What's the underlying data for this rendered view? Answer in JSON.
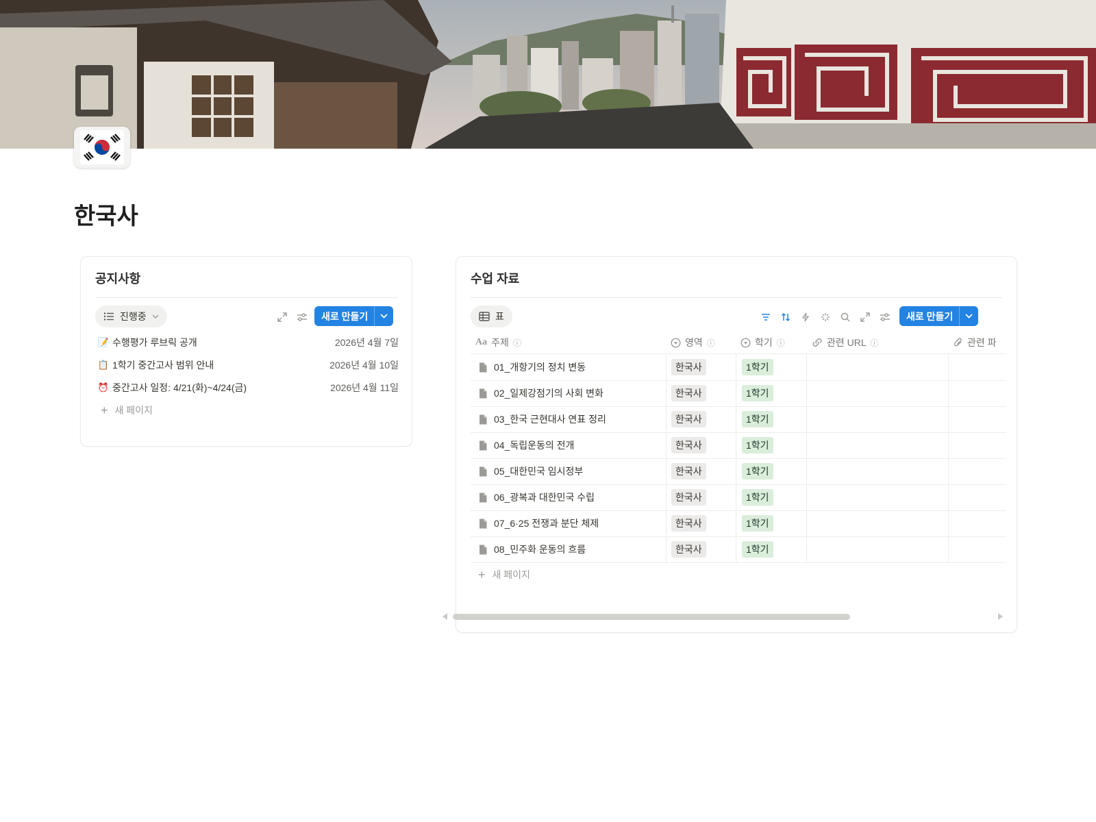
{
  "page": {
    "title": "한국사",
    "cover_alt": "hanok-village-cover"
  },
  "notices": {
    "title": "공지사항",
    "view_label": "진행중",
    "new_button": "새로 만들기",
    "items": [
      {
        "emoji": "📝",
        "title": "수행평가 루브릭 공개",
        "date": "2026년 4월 7일"
      },
      {
        "emoji": "📋",
        "title": "1학기 중간고사 범위 안내",
        "date": "2026년 4월 10일"
      },
      {
        "emoji": "⏰",
        "title": "중간고사 일정: 4/21(화)~4/24(금)",
        "date": "2026년 4월 11일"
      }
    ],
    "new_page": "새 페이지"
  },
  "materials": {
    "title": "수업 자료",
    "view_label": "표",
    "new_button": "새로 만들기",
    "columns": {
      "title": "주제",
      "area": "영역",
      "semester": "학기",
      "url": "관련 URL",
      "file": "관련 파"
    },
    "rows": [
      {
        "title": "01_개항기의 정치 변동",
        "area": "한국사",
        "semester": "1학기"
      },
      {
        "title": "02_일제강점기의 사회 변화",
        "area": "한국사",
        "semester": "1학기"
      },
      {
        "title": "03_한국 근현대사 연표 정리",
        "area": "한국사",
        "semester": "1학기"
      },
      {
        "title": "04_독립운동의 전개",
        "area": "한국사",
        "semester": "1학기"
      },
      {
        "title": "05_대한민국 임시정부",
        "area": "한국사",
        "semester": "1학기"
      },
      {
        "title": "06_광복과 대한민국 수립",
        "area": "한국사",
        "semester": "1학기"
      },
      {
        "title": "07_6·25 전쟁과 분단 체제",
        "area": "한국사",
        "semester": "1학기"
      },
      {
        "title": "08_민주화 운동의 흐름",
        "area": "한국사",
        "semester": "1학기"
      }
    ],
    "new_page": "새 페이지"
  },
  "colors": {
    "accent": "#2383e2",
    "semester_tag_bg": "#dbeddb",
    "area_tag_bg": "#ebeae8"
  }
}
